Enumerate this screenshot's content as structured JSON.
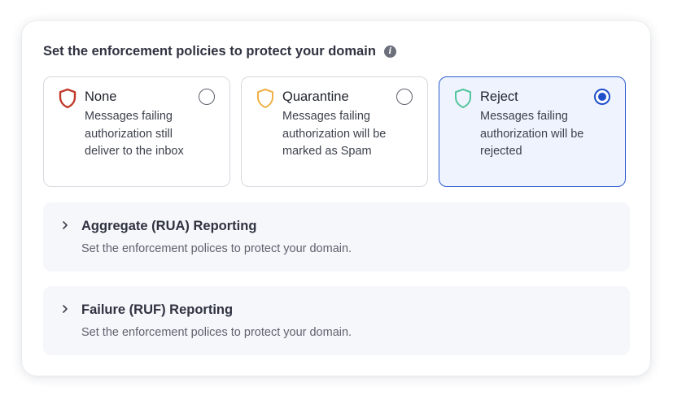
{
  "heading": "Set the enforcement policies to protect your domain",
  "info_icon": "info-icon",
  "options": [
    {
      "title": "None",
      "description": "Messages failing authorization still deliver to the inbox",
      "icon": "shield-icon",
      "icon_color": "#c0392b",
      "selected": false
    },
    {
      "title": "Quarantine",
      "description": "Messages failing authorization will be marked as Spam",
      "icon": "shield-icon",
      "icon_color": "#f0b043",
      "selected": false
    },
    {
      "title": "Reject",
      "description": "Messages failing authorization will be rejected",
      "icon": "shield-icon",
      "icon_color": "#52c49b",
      "selected": true
    }
  ],
  "sections": [
    {
      "title": "Aggregate (RUA) Reporting",
      "description": "Set the enforcement polices to protect your domain.",
      "icon": "chevron-right-icon"
    },
    {
      "title": "Failure (RUF) Reporting",
      "description": "Set the enforcement polices to protect your domain.",
      "icon": "chevron-right-icon"
    }
  ],
  "colors": {
    "accent": "#1f4fc9",
    "selected_bg": "#eef3fe",
    "section_bg": "#f6f7fb"
  }
}
